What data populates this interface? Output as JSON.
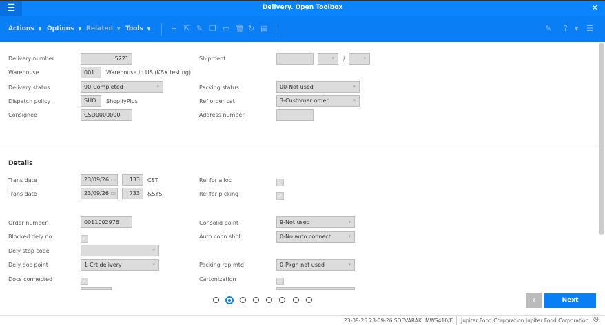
{
  "window": {
    "title": "Delivery. Open Toolbox",
    "menu_icon": "hamburger-icon",
    "close_icon": "close-icon"
  },
  "toolbar": {
    "actions": "Actions",
    "options": "Options",
    "related": "Related",
    "tools": "Tools"
  },
  "header": {
    "delivery_number_label": "Delivery number",
    "delivery_number": "5221",
    "warehouse_label": "Warehouse",
    "warehouse": "001",
    "warehouse_desc": "Warehouse in US (KBX testing)",
    "delivery_status_label": "Delivery status",
    "delivery_status": "90-Completed",
    "dispatch_policy_label": "Dispatch policy",
    "dispatch_policy": "SHO",
    "dispatch_policy_desc": "ShopifyPlus",
    "consignee_label": "Consignee",
    "consignee": "CSD0000000",
    "shipment_label": "Shipment",
    "shipment_sep": "/",
    "packing_status_label": "Packing status",
    "packing_status": "00-Not used",
    "ref_order_cat_label": "Ref order cat",
    "ref_order_cat": "3-Customer order",
    "address_number_label": "Address number"
  },
  "details": {
    "title": "Details",
    "trans_date_label": "Trans date",
    "trans_date1": "23/09/26",
    "trans_time1": "133",
    "trans_zone1": "CST",
    "trans_date2": "23/09/26",
    "trans_time2": "733",
    "trans_zone2": "&SYS",
    "rel_alloc_label": "Rel for alloc",
    "rel_alloc": true,
    "rel_picking_label": "Rel for picking",
    "rel_picking": true,
    "order_number_label": "Order number",
    "order_number": "0011002976",
    "blocked_label": "Blocked dely no",
    "blocked": true,
    "stop_code_label": "Dely stop code",
    "stop_code": "",
    "doc_point_label": "Dely doc point",
    "doc_point": "1-Crt delivery",
    "docs_connected_label": "Docs connected",
    "docs_connected": true,
    "consolid_label": "Consolid point",
    "consolid": "9-Not used",
    "auto_conn_label": "Auto conn shpt",
    "auto_conn": "0-No auto connect",
    "packing_rep_label": "Packing rep mtd",
    "packing_rep": "0-Pkgn not used",
    "cartonization_label": "Cartonization",
    "cartonization": false
  },
  "pager": {
    "pages": 8,
    "current": 2,
    "next": "Next"
  },
  "status": {
    "dates_user": "23-09-26 23-09-26 SDEVARAK",
    "program": "MWS410/E",
    "company": "Jupiter Food Corporation Jupiter Food Corporation"
  }
}
